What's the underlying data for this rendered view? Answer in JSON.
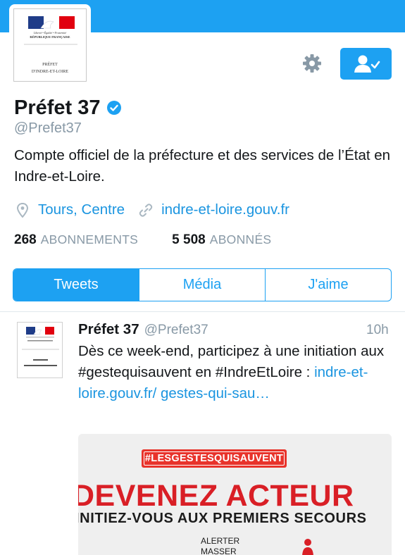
{
  "colors": {
    "accent": "#1da1f2",
    "link": "#1b95e0",
    "muted": "#8899a6",
    "poster_red": "#d91f26"
  },
  "profile": {
    "avatar_logo_line1": "Liberté • Égalité • Fraternité",
    "avatar_logo_line2": "RÉPUBLIQUE FRANÇAISE",
    "avatar_caption_line1": "PRÉFET",
    "avatar_caption_line2": "D'INDRE-ET-LOIRE",
    "name": "Préfet 37",
    "verified_icon": "verified-badge-icon",
    "handle": "@Prefet37",
    "bio": "Compte officiel de la préfecture et des services de l’État en Indre-et-Loire.",
    "location_icon": "location-pin-icon",
    "location": "Tours, Centre",
    "website_icon": "link-icon",
    "website": "indre-et-loire.gouv.fr",
    "following_count": "268",
    "following_label": "ABONNEMENTS",
    "followers_count": "5 508",
    "followers_label": "ABONNÉS"
  },
  "actions": {
    "settings_icon": "gear-icon",
    "following_icon": "user-check-icon"
  },
  "tabs": [
    {
      "label": "Tweets",
      "active": true
    },
    {
      "label": "Média",
      "active": false
    },
    {
      "label": "J'aime",
      "active": false
    }
  ],
  "tweet": {
    "name": "Préfet 37",
    "handle": "@Prefet37",
    "time": "10h",
    "text": "Dès ce week-end, participez à une initiation aux #gestequisauvent en #IndreEtLoire : ",
    "link": "indre-et-loire.gouv.fr/ gestes-qui-sau…",
    "media": {
      "hashtag": "#LESGESTESQUISAUVENT",
      "title": "DEVENEZ ACTEUR",
      "subtitle": "INITIEZ-VOUS AUX PREMIERS SECOURS",
      "line1": "ALERTER",
      "line2": "MASSER"
    }
  }
}
